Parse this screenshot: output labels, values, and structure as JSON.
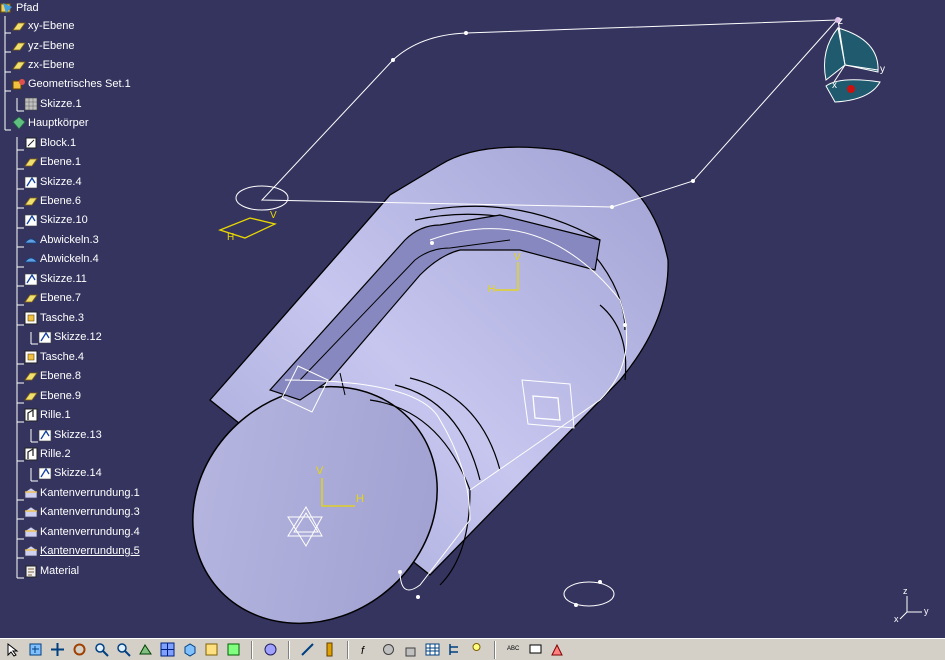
{
  "tree": {
    "root": "Pfad",
    "items": [
      {
        "label": "xy-Ebene",
        "icon": "plane-icon"
      },
      {
        "label": "yz-Ebene",
        "icon": "plane-icon"
      },
      {
        "label": "zx-Ebene",
        "icon": "plane-icon"
      },
      {
        "label": "Geometrisches Set.1",
        "icon": "geometrical-set-icon"
      },
      {
        "label": "Skizze.1",
        "icon": "sketch-grid-icon"
      },
      {
        "label": "Hauptkörper",
        "icon": "body-icon"
      },
      {
        "label": "Block.1",
        "icon": "pad-icon"
      },
      {
        "label": "Ebene.1",
        "icon": "plane-icon"
      },
      {
        "label": "Skizze.4",
        "icon": "sketch-icon"
      },
      {
        "label": "Ebene.6",
        "icon": "plane-icon"
      },
      {
        "label": "Skizze.10",
        "icon": "sketch-icon"
      },
      {
        "label": "Abwickeln.3",
        "icon": "unwrap-icon"
      },
      {
        "label": "Abwickeln.4",
        "icon": "unwrap-icon"
      },
      {
        "label": "Skizze.11",
        "icon": "sketch-icon"
      },
      {
        "label": "Ebene.7",
        "icon": "plane-icon"
      },
      {
        "label": "Tasche.3",
        "icon": "pocket-icon"
      },
      {
        "label": "Skizze.12",
        "icon": "sketch-icon"
      },
      {
        "label": "Tasche.4",
        "icon": "pocket-icon"
      },
      {
        "label": "Ebene.8",
        "icon": "plane-icon"
      },
      {
        "label": "Ebene.9",
        "icon": "plane-icon"
      },
      {
        "label": "Rille.1",
        "icon": "groove-icon"
      },
      {
        "label": "Skizze.13",
        "icon": "sketch-icon"
      },
      {
        "label": "Rille.2",
        "icon": "groove-icon"
      },
      {
        "label": "Skizze.14",
        "icon": "sketch-icon"
      },
      {
        "label": "Kantenverrundung.1",
        "icon": "edge-fillet-icon"
      },
      {
        "label": "Kantenverrundung.3",
        "icon": "edge-fillet-icon"
      },
      {
        "label": "Kantenverrundung.4",
        "icon": "edge-fillet-icon"
      },
      {
        "label": "Kantenverrundung.5",
        "icon": "edge-fillet-icon"
      },
      {
        "label": "Material",
        "icon": "material-icon"
      }
    ]
  },
  "compass": {
    "x": "x",
    "y": "y",
    "z": "z"
  },
  "axis_triad": {
    "x": "x",
    "y": "y",
    "z": "z"
  },
  "sketch_axes": {
    "h": "H",
    "v": "V"
  },
  "colors": {
    "background": "#35345f",
    "part": "#c4c4ec",
    "sketch_axis": "#e8d800",
    "curve": "#ffffff",
    "compass_face": "#1f5a6e"
  },
  "toolbar": {
    "buttons": [
      "select-icon",
      "fit-all-icon",
      "pan-icon",
      "rotate-icon",
      "zoom-in-icon",
      "zoom-out-icon",
      "normal-view-icon",
      "multi-view-icon",
      "iso-view-icon",
      "hide-show-icon",
      "swap-visible-icon",
      "sep",
      "shading-icon",
      "sep",
      "measure-icon",
      "material-apply-icon",
      "sep",
      "formula-icon",
      "catalog-icon",
      "lock-icon",
      "table-icon",
      "tree-icon",
      "knowledge-icon",
      "sep",
      "spell-icon",
      "comment-icon",
      "analysis-icon"
    ]
  }
}
